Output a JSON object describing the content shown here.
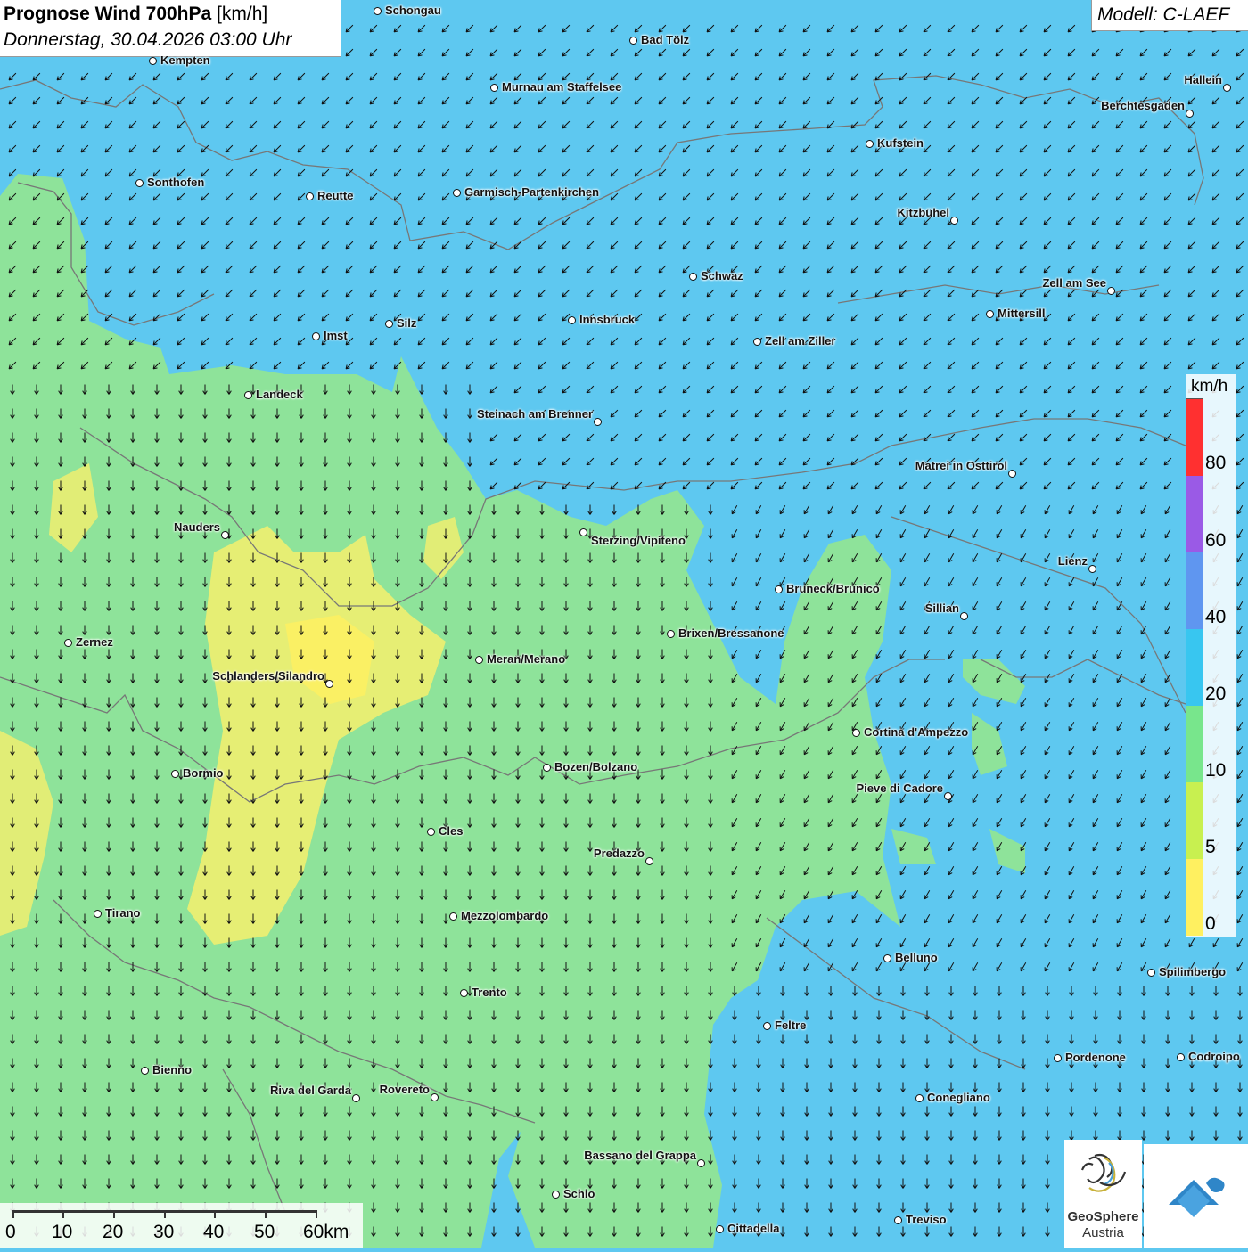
{
  "header": {
    "title_main": "Prognose Wind 700hPa",
    "title_unit": "[km/h]",
    "datetime": "Donnerstag, 30.04.2026 03:00 Uhr",
    "model": "Modell: C-LAEF"
  },
  "legend": {
    "unit": "km/h",
    "labels": [
      "80",
      "60",
      "40",
      "20",
      "10",
      "5",
      "0"
    ],
    "colors": [
      "#ff3030",
      "#9a5ae6",
      "#5f96f0",
      "#38c6f0",
      "#78e68c",
      "#c8f050",
      "#fff060"
    ]
  },
  "scale_bar": {
    "labels": [
      "0",
      "10",
      "20",
      "30",
      "40",
      "50",
      "60km"
    ]
  },
  "logos": {
    "geosphere_line1": "GeoSphere",
    "geosphere_line2": "Austria"
  },
  "colors": {
    "wind_10_20": "#5ec8f0",
    "wind_5_10": "#8ee39a",
    "wind_0_5": "#f0ee70",
    "wind_5_band": "#c8ec7a"
  },
  "cities": [
    {
      "name": "Schongau"
    },
    {
      "name": "Bad Tölz"
    },
    {
      "name": "Kempten"
    },
    {
      "name": "Murnau am Staffelsee"
    },
    {
      "name": "Hallein"
    },
    {
      "name": "Berchtesgaden"
    },
    {
      "name": "Kufstein"
    },
    {
      "name": "Sonthofen"
    },
    {
      "name": "Reutte"
    },
    {
      "name": "Garmisch-Partenkirchen"
    },
    {
      "name": "Kitzbühel"
    },
    {
      "name": "Schwaz"
    },
    {
      "name": "Zell am See"
    },
    {
      "name": "Innsbruck"
    },
    {
      "name": "Mittersill"
    },
    {
      "name": "Silz"
    },
    {
      "name": "Imst"
    },
    {
      "name": "Zell am Ziller"
    },
    {
      "name": "Landeck"
    },
    {
      "name": "Steinach am Brenner"
    },
    {
      "name": "Matrei in Osttirol"
    },
    {
      "name": "Nauders"
    },
    {
      "name": "Sterzing/Vipiteno"
    },
    {
      "name": "Lienz"
    },
    {
      "name": "Bruneck/Brunico"
    },
    {
      "name": "Sillian"
    },
    {
      "name": "Zernez"
    },
    {
      "name": "Brixen/Bressanone"
    },
    {
      "name": "Meran/Merano"
    },
    {
      "name": "Schlanders/Silandro"
    },
    {
      "name": "Cortina d'Ampezzo"
    },
    {
      "name": "Bozen/Bolzano"
    },
    {
      "name": "Bormio"
    },
    {
      "name": "Pieve di Cadore"
    },
    {
      "name": "Cles"
    },
    {
      "name": "Predazzo"
    },
    {
      "name": "Tirano"
    },
    {
      "name": "Mezzolombardo"
    },
    {
      "name": "Belluno"
    },
    {
      "name": "Spilimbergo"
    },
    {
      "name": "Trento"
    },
    {
      "name": "Feltre"
    },
    {
      "name": "Pordenone"
    },
    {
      "name": "Codroipo"
    },
    {
      "name": "Bienno"
    },
    {
      "name": "Riva del Garda"
    },
    {
      "name": "Rovereto"
    },
    {
      "name": "Conegliano"
    },
    {
      "name": "Bassano del Grappa"
    },
    {
      "name": "Schio"
    },
    {
      "name": "Treviso"
    },
    {
      "name": "Cittadella"
    }
  ]
}
